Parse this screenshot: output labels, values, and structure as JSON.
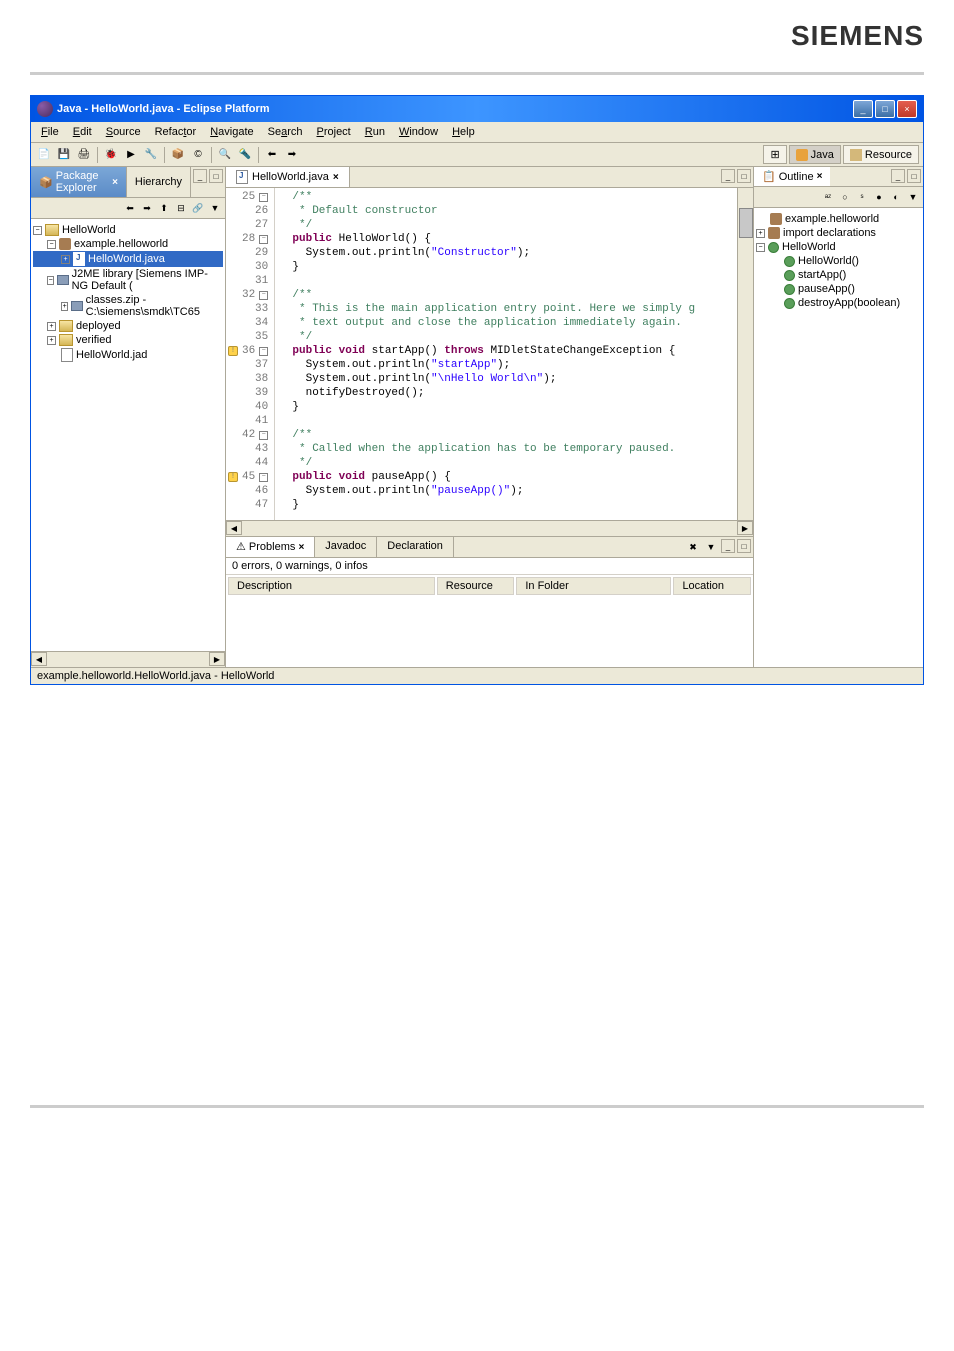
{
  "brand": "SIEMENS",
  "window": {
    "title": "Java - HelloWorld.java - Eclipse Platform"
  },
  "menu": {
    "file": "File",
    "edit": "Edit",
    "source": "Source",
    "refactor": "Refactor",
    "navigate": "Navigate",
    "search": "Search",
    "project": "Project",
    "run": "Run",
    "window": "Window",
    "help": "Help"
  },
  "perspectives": {
    "java": "Java",
    "resource": "Resource"
  },
  "packageExplorer": {
    "title": "Package Explorer",
    "hierarchyTab": "Hierarchy",
    "items": {
      "project": "HelloWorld",
      "package": "example.helloworld",
      "javaFile": "HelloWorld.java",
      "j2me": "J2ME library [Siemens IMP-NG Default (",
      "classes": "classes.zip - C:\\siemens\\smdk\\TC65",
      "deployed": "deployed",
      "verified": "verified",
      "jad": "HelloWorld.jad"
    }
  },
  "editor": {
    "tabTitle": "HelloWorld.java",
    "lines": [
      {
        "num": "25",
        "marker": "fold-open",
        "text": "  /**",
        "cls": "cm"
      },
      {
        "num": "26",
        "text": "   * Default constructor",
        "cls": "cm"
      },
      {
        "num": "27",
        "text": "   */",
        "cls": "cm"
      },
      {
        "num": "28",
        "marker": "fold",
        "html": "  <span class='kw'>public</span> HelloWorld() {"
      },
      {
        "num": "29",
        "html": "    System.out.println(<span class='st'>\"Constructor\"</span>);"
      },
      {
        "num": "30",
        "text": "  }"
      },
      {
        "num": "31",
        "text": ""
      },
      {
        "num": "32",
        "marker": "fold",
        "text": "  /**",
        "cls": "cm"
      },
      {
        "num": "33",
        "text": "   * This is the main application entry point. Here we simply g",
        "cls": "cm"
      },
      {
        "num": "34",
        "text": "   * text output and close the application immediately again.",
        "cls": "cm"
      },
      {
        "num": "35",
        "text": "   */",
        "cls": "cm"
      },
      {
        "num": "36",
        "marker": "warn-fold",
        "html": "  <span class='kw'>public void</span> startApp() <span class='kw'>throws</span> MIDletStateChangeException {"
      },
      {
        "num": "37",
        "html": "    System.out.println(<span class='st'>\"startApp\"</span>);"
      },
      {
        "num": "38",
        "html": "    System.out.println(<span class='st'>\"\\nHello World\\n\"</span>);"
      },
      {
        "num": "39",
        "text": "    notifyDestroyed();"
      },
      {
        "num": "40",
        "text": "  }"
      },
      {
        "num": "41",
        "text": ""
      },
      {
        "num": "42",
        "marker": "fold-open",
        "text": "  /**",
        "cls": "cm"
      },
      {
        "num": "43",
        "text": "   * Called when the application has to be temporary paused.",
        "cls": "cm"
      },
      {
        "num": "44",
        "text": "   */",
        "cls": "cm"
      },
      {
        "num": "45",
        "marker": "warn-fold",
        "html": "  <span class='kw'>public void</span> pauseApp() {"
      },
      {
        "num": "46",
        "html": "    System.out.println(<span class='st'>\"pauseApp()\"</span>);"
      },
      {
        "num": "47",
        "text": "  }"
      }
    ]
  },
  "outline": {
    "title": "Outline",
    "items": {
      "package": "example.helloworld",
      "imports": "import declarations",
      "class": "HelloWorld",
      "constructor": "HelloWorld()",
      "startApp": "startApp()",
      "pauseApp": "pauseApp()",
      "destroyApp": "destroyApp(boolean)"
    }
  },
  "problems": {
    "tabTitle": "Problems",
    "javadocTab": "Javadoc",
    "declarationTab": "Declaration",
    "summary": "0 errors, 0 warnings, 0 infos",
    "columns": {
      "description": "Description",
      "resource": "Resource",
      "inFolder": "In Folder",
      "location": "Location"
    }
  },
  "statusbar": {
    "text": "example.helloworld.HelloWorld.java - HelloWorld"
  }
}
